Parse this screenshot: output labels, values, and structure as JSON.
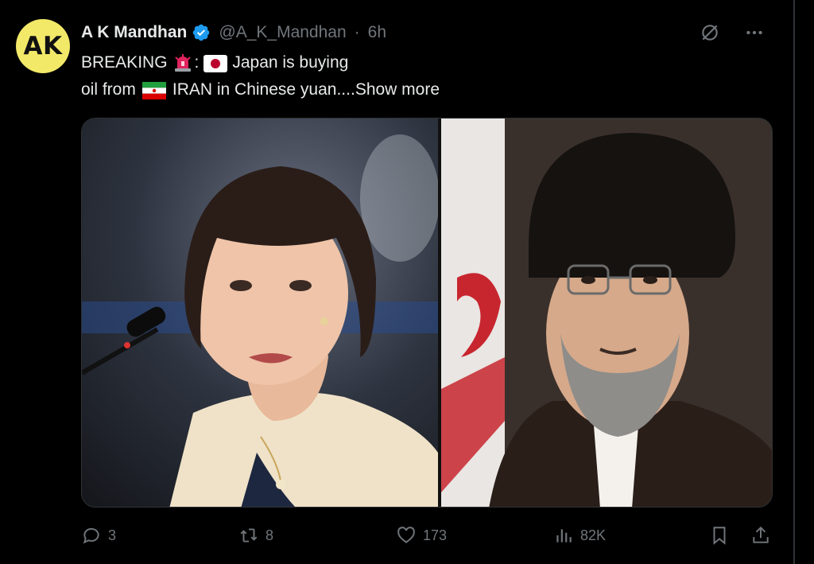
{
  "author": {
    "avatar_initials": "AK",
    "avatar_color": "#f3e969",
    "display_name": "A K Mandhan",
    "verified": true,
    "handle": "@A_K_Mandhan",
    "separator": "·",
    "time_ago": "6h"
  },
  "tweet": {
    "line1_prefix": "BREAKING",
    "line1_sep": ":",
    "line1_text": "Japan is buying",
    "line2_prefix": "oil from",
    "line2_text": "IRAN in Chinese yuan....",
    "show_more": "Show more",
    "emojis": [
      "rotating-light-icon",
      "japan-flag-icon",
      "iran-flag-icon"
    ]
  },
  "actions": {
    "replies": "3",
    "reposts": "8",
    "likes": "173",
    "views": "82K"
  },
  "colors": {
    "background": "#000000",
    "text": "#e7e9ea",
    "muted": "#71767b",
    "verified": "#1d9bf0"
  }
}
